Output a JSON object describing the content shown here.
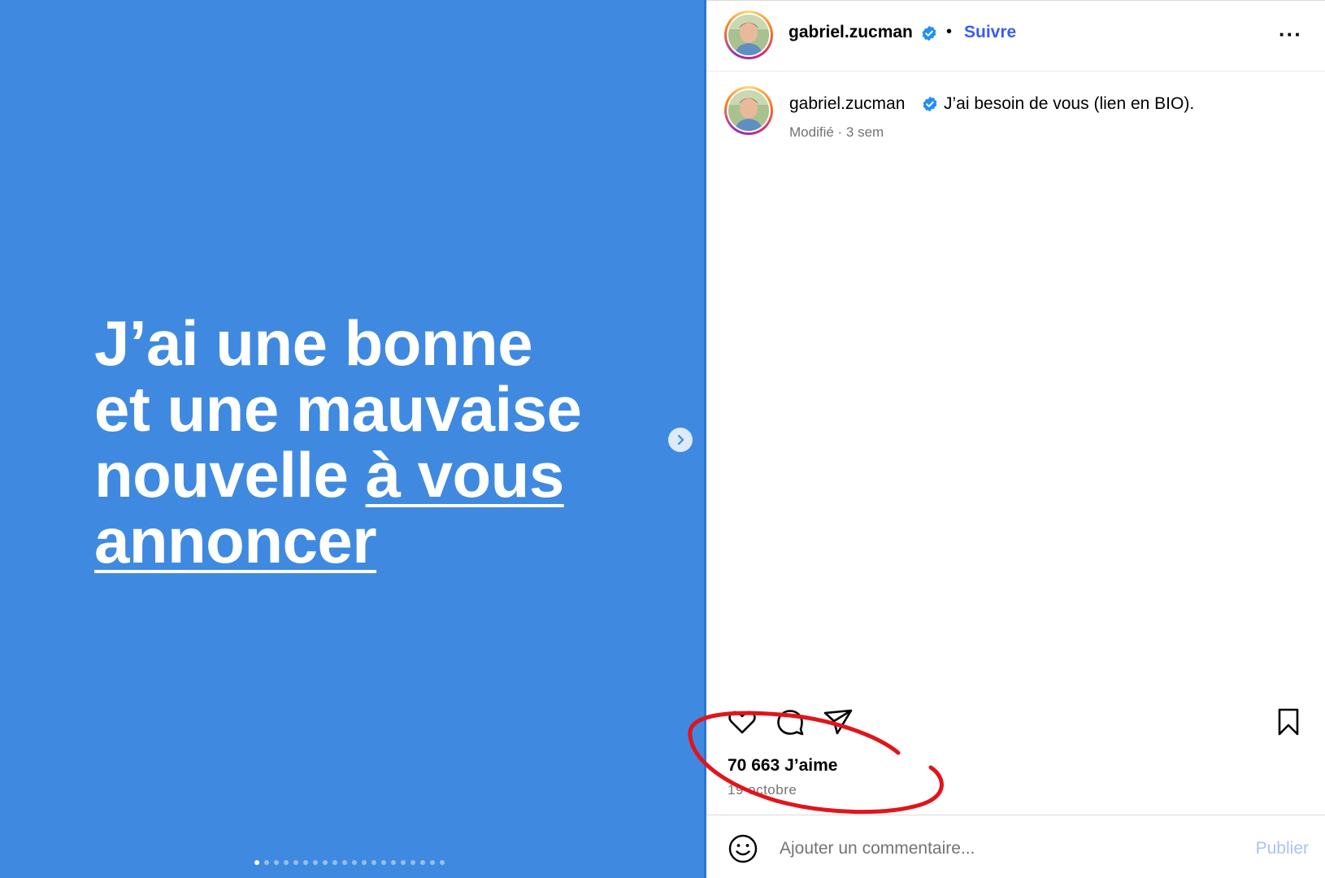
{
  "slide": {
    "line1": "J’ai une bonne",
    "line2": "et une mauvaise",
    "line3a": "nouvelle ",
    "line3b": "à vous",
    "line4": "annoncer",
    "background_color": "#3f8ae0",
    "dot_count": 20,
    "active_dot": 1
  },
  "header": {
    "username": "gabriel.zucman",
    "separator": "•",
    "follow_label": "Suivre",
    "more_label": "···"
  },
  "caption": {
    "username": "gabriel.zucman",
    "text": "J’ai besoin de vous (lien en BIO).",
    "meta": "Modifié · 3 sem"
  },
  "stats": {
    "likes": "70 663 J’aime",
    "date": "19 octobre"
  },
  "comment": {
    "placeholder": "Ajouter un commentaire...",
    "publish_label": "Publier"
  },
  "icons": {
    "like": "heart-icon",
    "comment": "comment-icon",
    "share": "paper-plane-icon",
    "save": "bookmark-icon",
    "emoji": "emoji-icon",
    "next": "chevron-right-icon",
    "verified": "verified-badge-icon"
  },
  "colors": {
    "follow": "#3b5cf0",
    "verified": "#1f8ff5",
    "annotation": "#e0151b"
  }
}
